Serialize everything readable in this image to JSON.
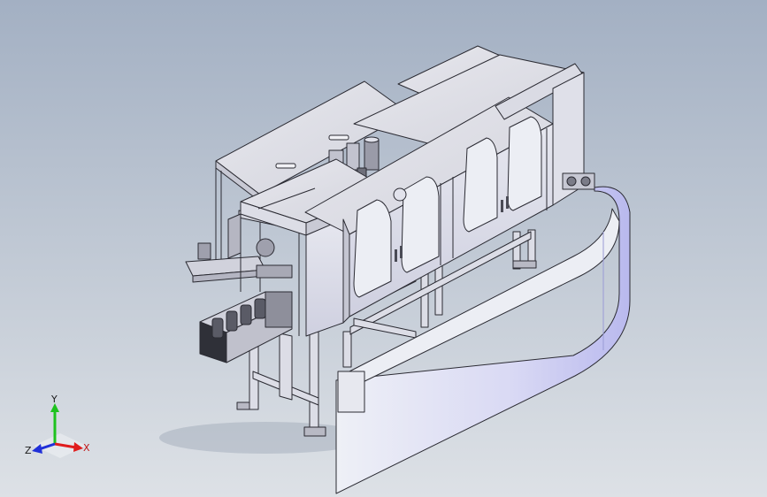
{
  "view": {
    "background_top": "#a3b0c3",
    "background_bottom": "#dde1e6",
    "model_face_color": "#d7d8e6",
    "model_edge_color": "#2b2b33",
    "guard_color": "#c9c9f2"
  },
  "triad": {
    "x_label": "X",
    "y_label": "Y",
    "z_label": "Z",
    "x_color": "#e01d1d",
    "y_color": "#1ec21e",
    "z_color": "#2030d8"
  }
}
